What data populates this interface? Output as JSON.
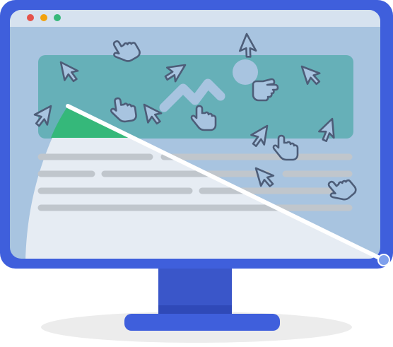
{
  "illustration": {
    "subject": "monitor-with-cursors-and-page-wipe",
    "colors": {
      "frame": "#3f5fdc",
      "frame_dark": "#2f49b8",
      "screen": "#a8c4e0",
      "titlebar": "#d6e2ef",
      "hero_banner": "#66b0b8",
      "hero_accent": "#35b87a",
      "revealed_page": "#e6ecf3",
      "text_lines": "#c0c6cc",
      "wipe_line": "#ffffff",
      "cursor_fill": "#a8c4e0",
      "cursor_stroke": "#4d5d78",
      "handle": "#7fa0ec",
      "shadow": "#ececec"
    },
    "window_controls": [
      {
        "name": "close-dot",
        "color": "#e5534b"
      },
      {
        "name": "minimize-dot",
        "color": "#f2a20d"
      },
      {
        "name": "maximize-dot",
        "color": "#35b87a"
      }
    ],
    "icons": [
      "mountain-image-icon",
      "sun-icon",
      "arrow-cursor-icon",
      "hand-pointer-icon",
      "pointing-hand-icon"
    ]
  }
}
